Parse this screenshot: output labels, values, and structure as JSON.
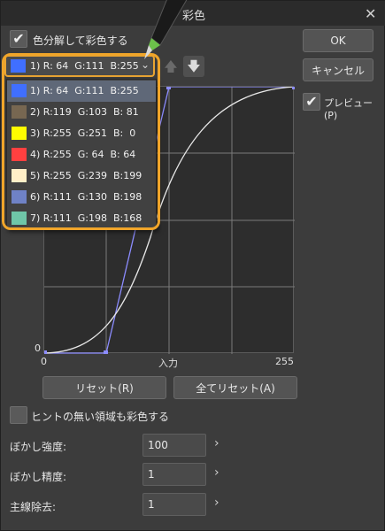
{
  "window": {
    "title": "彩色",
    "close_glyph": "✕"
  },
  "options": {
    "decompose_label": "色分解して彩色する",
    "decompose_checked": true,
    "preview_label": "プレビュー(P)",
    "preview_checked": true,
    "no_hint_label": "ヒントの無い領域も彩色する",
    "no_hint_checked": false
  },
  "dropdown": {
    "selected": {
      "label": "1) R: 64  G:111  B:255",
      "color": "#406fff"
    },
    "items": [
      {
        "label": "1) R: 64  G:111  B:255",
        "color": "#406fff"
      },
      {
        "label": "2) R:119  G:103  B: 81",
        "color": "#776751"
      },
      {
        "label": "3) R:255  G:251  B:  0",
        "color": "#fffb00"
      },
      {
        "label": "4) R:255  G: 64  B: 64",
        "color": "#ff4040"
      },
      {
        "label": "5) R:255  G:239  B:199",
        "color": "#ffefc7"
      },
      {
        "label": "6) R:111  G:130  B:198",
        "color": "#6f82c6"
      },
      {
        "label": "7) R:111  G:198  B:168",
        "color": "#6fc6a8"
      }
    ]
  },
  "buttons": {
    "ok": "OK",
    "cancel": "キャンセル",
    "reset": "リセット(R)",
    "reset_all": "全てリセット(A)",
    "up_arrow": "🡅",
    "down_arrow": "🡇"
  },
  "graph": {
    "x_min_label": "0",
    "x_axis_label": "入力",
    "x_max_label": "255",
    "y_min_label": "0"
  },
  "fields": {
    "blur_strength": {
      "label": "ぼかし強度:",
      "value": "100"
    },
    "blur_precision": {
      "label": "ぼかし精度:",
      "value": "1"
    },
    "line_removal": {
      "label": "主線除去:",
      "value": "1"
    },
    "chevron": "›"
  },
  "colors": {
    "annotation": "#f0a52a",
    "accent": "#8c8cff"
  }
}
